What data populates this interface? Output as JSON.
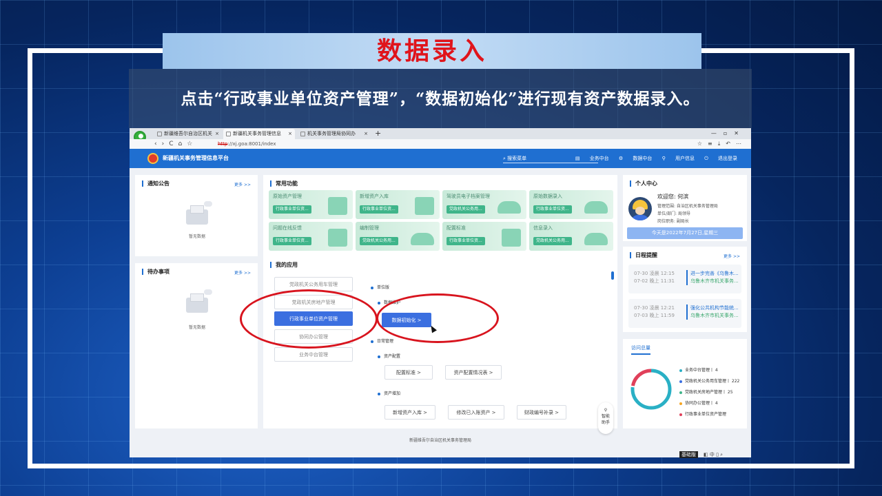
{
  "slide": {
    "title": "数据录入",
    "instruction": "点击“行政事业单位资产管理”，“数据初始化”进行现有资产数据录入。",
    "title_color": "#e0141b"
  },
  "browser": {
    "tabs": [
      {
        "label": "新疆维吾尔自治区机关",
        "icon": "page-icon"
      },
      {
        "label": "新疆机关事务管理信息",
        "icon": "app-icon"
      },
      {
        "label": "机关事务管理局协同办",
        "icon": "app-icon"
      }
    ],
    "url_scheme": "http",
    "url_rest": "://xj.goa:8001/index",
    "new_tab": "+",
    "window_controls": "—▫✕",
    "nav_buttons": "‹›C⌂☆",
    "right_tools": "☆≡⤓↶⋯"
  },
  "app": {
    "name": "新疆机关事务管理信息平台",
    "search_placeholder": "搜索菜单",
    "nav": [
      "业务中台",
      "数据中台",
      "用户信息",
      "退出登录"
    ],
    "accent": "#1f6fd1"
  },
  "notice": {
    "title": "通知公告",
    "more": "更多 >>",
    "empty": "暂无数据"
  },
  "todo": {
    "title": "待办事项",
    "more": "更多 >>",
    "empty": "暂无数据"
  },
  "common_functions": {
    "title": "常用功能",
    "tiles": [
      {
        "title": "原始资产管理",
        "tag": "行政事业单位资..."
      },
      {
        "title": "新增资产入库",
        "tag": "行政事业单位资..."
      },
      {
        "title": "驾驶员电子档案管理",
        "tag": "党政机关公务用..."
      },
      {
        "title": "原始数据录入",
        "tag": "行政事业单位资..."
      },
      {
        "title": "问题在线反馈",
        "tag": "行政事业单位资..."
      },
      {
        "title": "编制管理",
        "tag": "党政机关公务用..."
      },
      {
        "title": "配置标准",
        "tag": "行政事业单位资..."
      },
      {
        "title": "信息录入",
        "tag": "党政机关公务用..."
      }
    ]
  },
  "my_apps": {
    "title": "我的应用",
    "apps": [
      "党政机关公务用车管理",
      "党政机关房地产管理",
      "行政事业单位资产管理",
      "协同办公管理",
      "业务中台管理"
    ],
    "tree": {
      "unit": "单位版",
      "maintenance": "数据维护",
      "init_button": "数据初始化 >",
      "daily": "日常管理",
      "allocation": "资产配置",
      "allocation_buttons": [
        "配置标准 >",
        "资产配置情况表 >"
      ],
      "addition": "资产增加",
      "addition_buttons": [
        "新增资产入库 >",
        "修改已入账资产 >",
        "财政编号补录 >"
      ]
    }
  },
  "personal": {
    "title": "个人中心",
    "welcome": "欢迎您:  何滨",
    "scope": "管理范围: 自治区机关事务管理局",
    "dept": "单位/部门: 局领导",
    "position": "岗位职务: 副局长",
    "date": "今天是2022年7月27日,星期三"
  },
  "schedule": {
    "title": "日程提醒",
    "more": "更多 >>",
    "items": [
      {
        "time1": "07-30 凌晨 12:15",
        "time2": "07-02 晚上 11:31",
        "title": "进一步完善《乌鲁木...",
        "org": "乌鲁木齐市机关事务..."
      },
      {
        "time1": "07-30 凌晨 12:21",
        "time2": "07-03 晚上 11:59",
        "title": "强化公共机构节能统...",
        "org": "乌鲁木齐市机关事务..."
      }
    ]
  },
  "visits": {
    "title": "访问总量",
    "legend": [
      {
        "label": "业务中台管理丨 4",
        "color": "#2ab0c5"
      },
      {
        "label": "党政机关公务用车管理丨 222",
        "color": "#3b6fe0"
      },
      {
        "label": "党政机关房地产管理丨 25",
        "color": "#3fb58a"
      },
      {
        "label": "协同办公管理丨 4",
        "color": "#f5a623"
      },
      {
        "label": "行政事业单位资产管理",
        "color": "#e0405a"
      }
    ]
  },
  "footer": "新疆维吾尔自治区机关事务管理局",
  "assistant": {
    "label1": "智能",
    "label2": "助手",
    "icon": "link-icon"
  },
  "statusbar": {
    "base": "基础版",
    "icons": "◧  中  ▯  ⌕"
  }
}
